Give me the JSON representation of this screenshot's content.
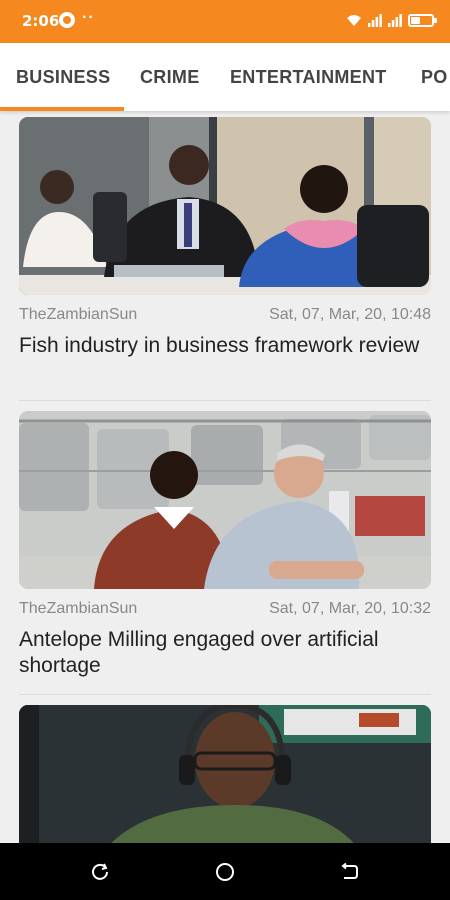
{
  "status_bar": {
    "time": "2:06",
    "dots": "··",
    "icons": [
      "app-notification-icon",
      "wifi-icon",
      "signal-icon",
      "signal-icon",
      "battery-icon"
    ]
  },
  "tabs": [
    {
      "label": "BUSINESS",
      "active": true
    },
    {
      "label": "CRIME",
      "active": false
    },
    {
      "label": "ENTERTAINMENT",
      "active": false
    },
    {
      "label": "PO",
      "active": false
    }
  ],
  "accent_color": "#f5891f",
  "articles": [
    {
      "source": "TheZambianSun",
      "date": "Sat, 07, Mar, 20, 10:48",
      "title": "Fish industry in business framework review"
    },
    {
      "source": "TheZambianSun",
      "date": "Sat, 07, Mar, 20, 10:32",
      "title": "Antelope Milling engaged over artificial shortage"
    },
    {
      "source": "",
      "date": "",
      "title": ""
    }
  ],
  "nav_bar": {
    "icons": [
      "recent-apps-icon",
      "home-icon",
      "back-icon"
    ]
  }
}
